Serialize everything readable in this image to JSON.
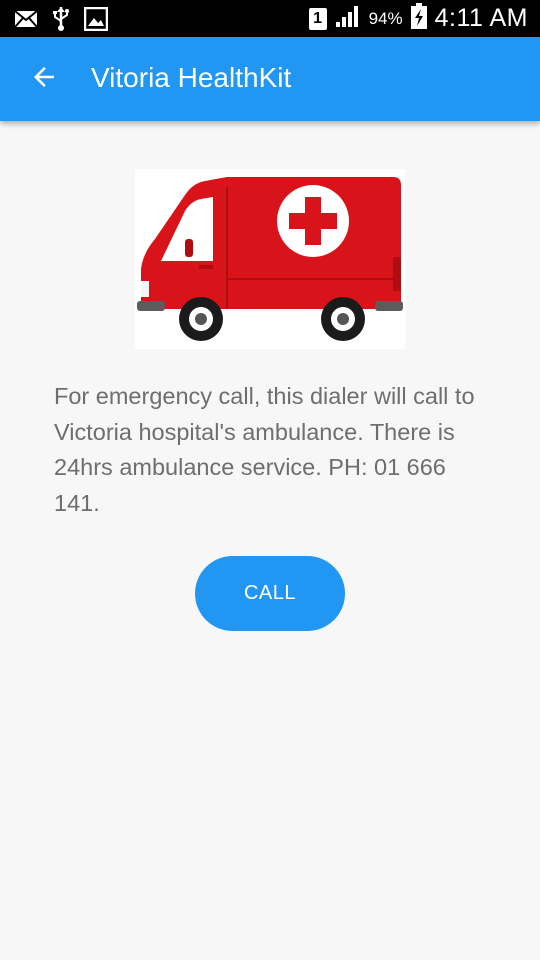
{
  "status_bar": {
    "icons": [
      "mail-icon",
      "usb-icon",
      "image-icon",
      "sim-icon",
      "signal-icon",
      "battery-icon"
    ],
    "sim_number": "1",
    "battery_percent": "94%",
    "time": "4:11 AM"
  },
  "app_bar": {
    "back_icon": "arrow-back-icon",
    "title": "Vitoria HealthKit",
    "color": "#2196f3"
  },
  "content": {
    "image_icon": "ambulance-icon",
    "description": "For emergency call, this dialer will call to Victoria hospital's ambulance. There is 24hrs ambulance service. PH: 01 666 141.",
    "call_label": "CALL"
  }
}
